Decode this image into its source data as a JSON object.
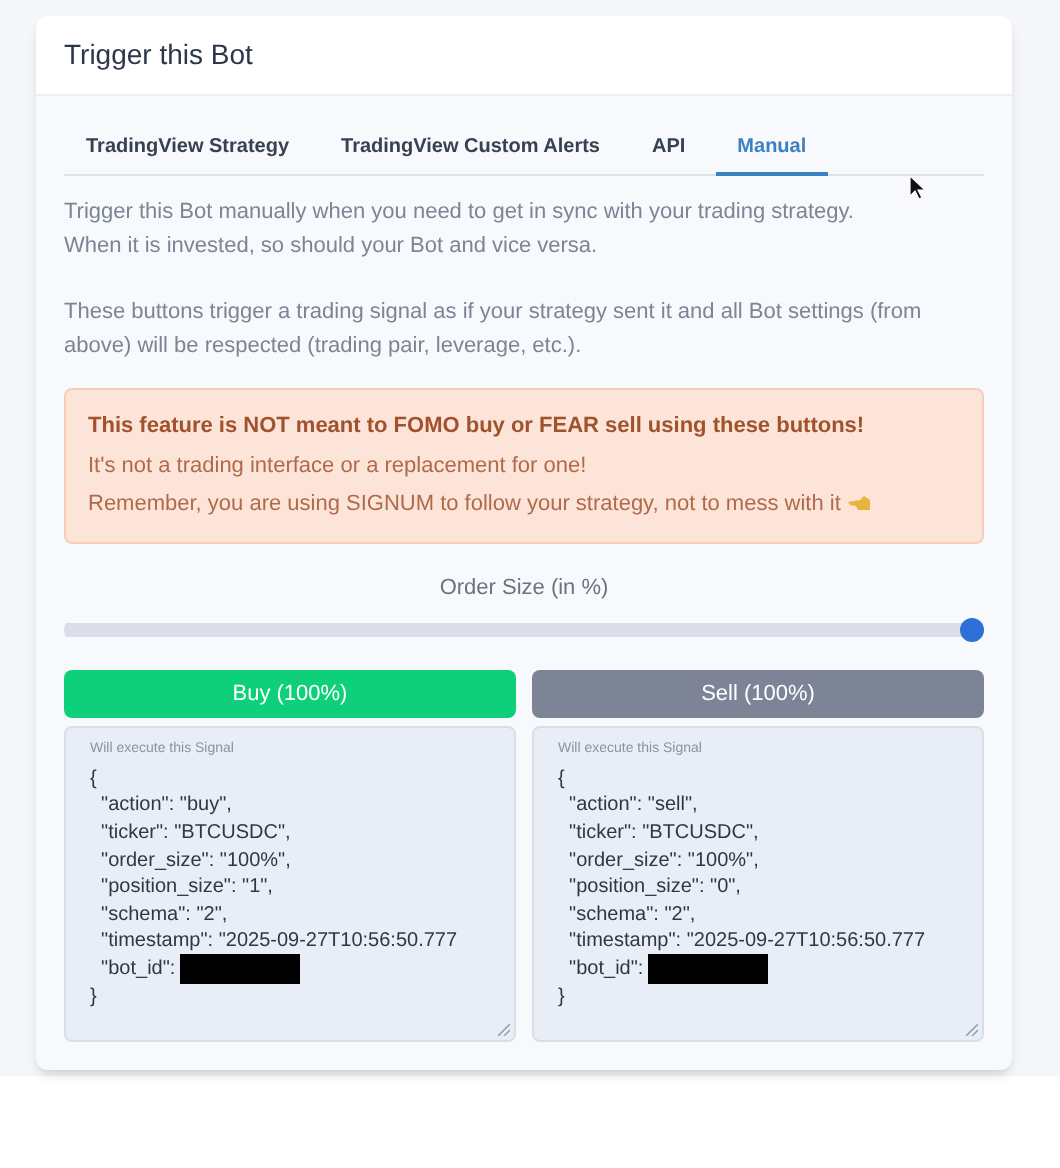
{
  "card": {
    "title": "Trigger this Bot"
  },
  "tabs": [
    {
      "label": "TradingView Strategy",
      "selected": false
    },
    {
      "label": "TradingView Custom Alerts",
      "selected": false
    },
    {
      "label": "API",
      "selected": false
    },
    {
      "label": "Manual",
      "selected": true
    }
  ],
  "intro": [
    "Trigger this Bot manually when you need to get in sync with your trading strategy.\nWhen it is invested, so should your Bot and vice versa.",
    "These buttons trigger a trading signal as if your strategy sent it and all Bot settings (from above) will be respected (trading pair, leverage, etc.)."
  ],
  "warning": {
    "heading": "This feature is NOT meant to FOMO buy or FEAR sell using these buttons!",
    "lines": [
      "It's not a trading interface or a replacement for one!",
      "Remember, you are using SIGNUM to follow your strategy, not to mess with it"
    ]
  },
  "order_size": {
    "label": "Order Size (in %)",
    "level": 1.0
  },
  "actions": [
    {
      "kind": "buy",
      "button": "Buy (100%)",
      "signal_label": "Will execute this Signal",
      "lines": [
        "{",
        "  \"action\": \"buy\",",
        "  \"ticker\": \"BTCUSDC\",",
        "  \"order_size\": \"100%\",",
        "  \"position_size\": \"1\",",
        "  \"schema\": \"2\",",
        "  \"timestamp\": \"2025-09-27T10:56:50.777",
        "  \"bot_id\": ",
        "}"
      ]
    },
    {
      "kind": "sell",
      "button": "Sell (100%)",
      "signal_label": "Will execute this Signal",
      "lines": [
        "{",
        "  \"action\": \"sell\",",
        "  \"ticker\": \"BTCUSDC\",",
        "  \"order_size\": \"100%\",",
        "  \"position_size\": \"0\",",
        "  \"schema\": \"2\",",
        "  \"timestamp\": \"2025-09-27T10:56:50.777",
        "  \"bot_id\": ",
        "}"
      ]
    }
  ]
}
